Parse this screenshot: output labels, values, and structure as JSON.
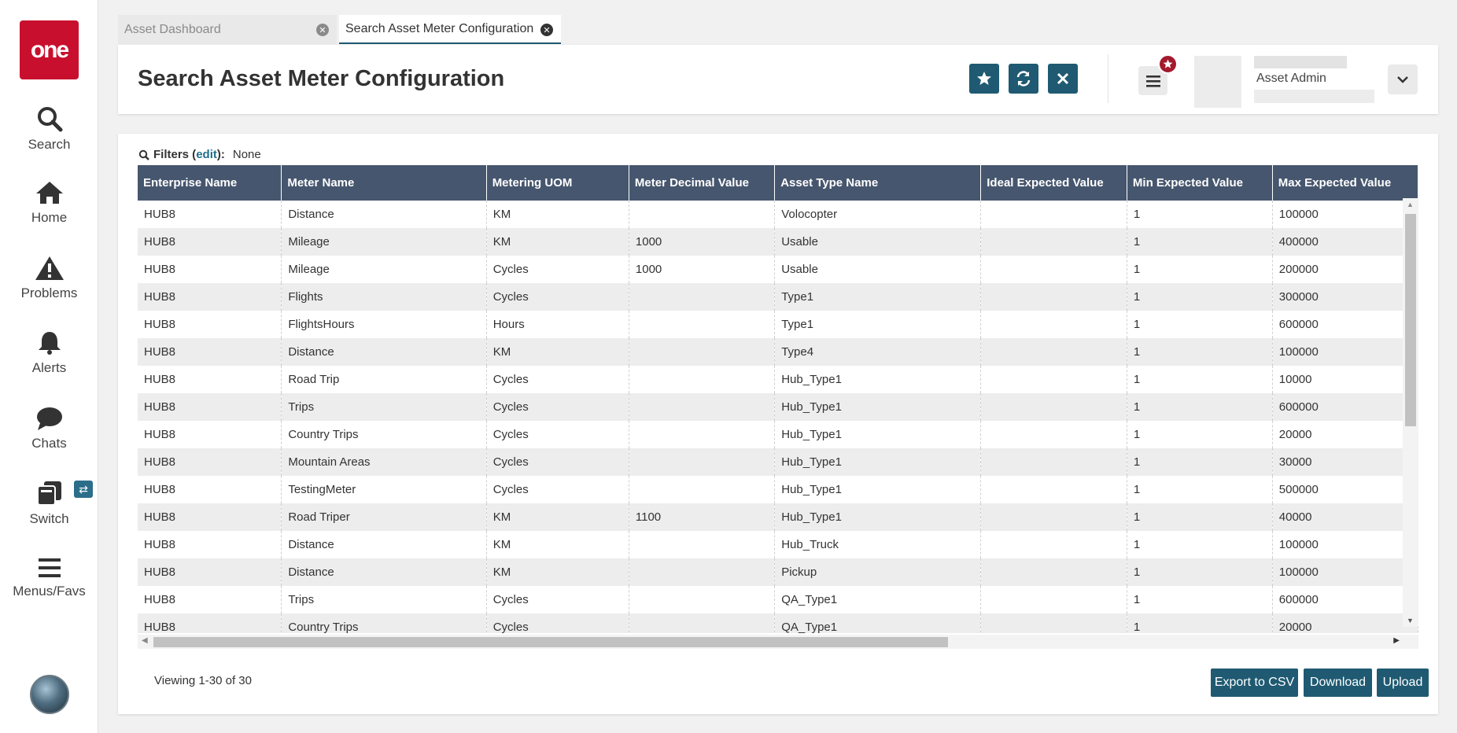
{
  "sidebar": {
    "logo": "one",
    "items": [
      {
        "label": "Search",
        "icon": "search-icon"
      },
      {
        "label": "Home",
        "icon": "home-icon"
      },
      {
        "label": "Problems",
        "icon": "warning-icon"
      },
      {
        "label": "Alerts",
        "icon": "bell-icon"
      },
      {
        "label": "Chats",
        "icon": "chat-icon"
      },
      {
        "label": "Switch",
        "icon": "switch-icon"
      },
      {
        "label": "Menus/Favs",
        "icon": "menu-icon"
      }
    ],
    "switch_badge": "⇄"
  },
  "tabs": [
    {
      "label": "Asset Dashboard",
      "active": false
    },
    {
      "label": "Search Asset Meter Configuration",
      "active": true
    }
  ],
  "header": {
    "title": "Search Asset Meter Configuration",
    "user_name": "Asset Admin"
  },
  "filters": {
    "label": "Filters (",
    "edit": "edit",
    "suffix": "):",
    "value": "None"
  },
  "table": {
    "columns": [
      "Enterprise Name",
      "Meter Name",
      "Metering UOM",
      "Meter Decimal Value",
      "Asset Type Name",
      "Ideal Expected Value",
      "Min Expected Value",
      "Max Expected Value"
    ],
    "rows": [
      [
        "HUB8",
        "Distance",
        "KM",
        "",
        "Volocopter",
        "",
        "1",
        "100000"
      ],
      [
        "HUB8",
        "Mileage",
        "KM",
        "1000",
        "Usable",
        "",
        "1",
        "400000"
      ],
      [
        "HUB8",
        "Mileage",
        "Cycles",
        "1000",
        "Usable",
        "",
        "1",
        "200000"
      ],
      [
        "HUB8",
        "Flights",
        "Cycles",
        "",
        "Type1",
        "",
        "1",
        "300000"
      ],
      [
        "HUB8",
        "FlightsHours",
        "Hours",
        "",
        "Type1",
        "",
        "1",
        "600000"
      ],
      [
        "HUB8",
        "Distance",
        "KM",
        "",
        "Type4",
        "",
        "1",
        "100000"
      ],
      [
        "HUB8",
        "Road Trip",
        "Cycles",
        "",
        "Hub_Type1",
        "",
        "1",
        "10000"
      ],
      [
        "HUB8",
        "Trips",
        "Cycles",
        "",
        "Hub_Type1",
        "",
        "1",
        "600000"
      ],
      [
        "HUB8",
        "Country Trips",
        "Cycles",
        "",
        "Hub_Type1",
        "",
        "1",
        "20000"
      ],
      [
        "HUB8",
        "Mountain Areas",
        "Cycles",
        "",
        "Hub_Type1",
        "",
        "1",
        "30000"
      ],
      [
        "HUB8",
        "TestingMeter",
        "Cycles",
        "",
        "Hub_Type1",
        "",
        "1",
        "500000"
      ],
      [
        "HUB8",
        "Road Triper",
        "KM",
        "1100",
        "Hub_Type1",
        "",
        "1",
        "40000"
      ],
      [
        "HUB8",
        "Distance",
        "KM",
        "",
        "Hub_Truck",
        "",
        "1",
        "100000"
      ],
      [
        "HUB8",
        "Distance",
        "KM",
        "",
        "Pickup",
        "",
        "1",
        "100000"
      ],
      [
        "HUB8",
        "Trips",
        "Cycles",
        "",
        "QA_Type1",
        "",
        "1",
        "600000"
      ],
      [
        "HUB8",
        "Country Trips",
        "Cycles",
        "",
        "QA_Type1",
        "",
        "1",
        "20000"
      ]
    ]
  },
  "footer": {
    "viewing": "Viewing 1-30 of 30",
    "buttons": [
      "Export to CSV",
      "Download",
      "Upload"
    ]
  },
  "colors": {
    "brand_red": "#c8102e",
    "primary": "#1f5a72",
    "table_header": "#46566e"
  }
}
